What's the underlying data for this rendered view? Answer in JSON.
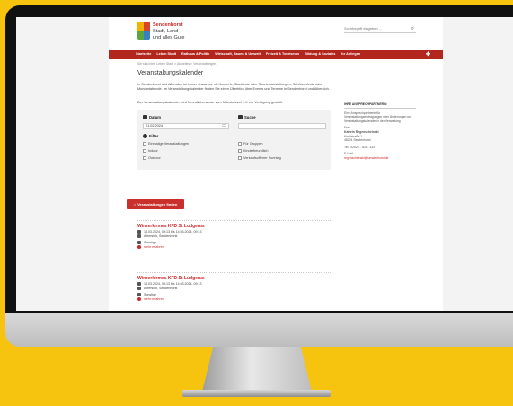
{
  "site": {
    "logo_line1": "Sendenhorst",
    "logo_line2": "Stadt, Land",
    "logo_line3": "und alles Gute",
    "search_placeholder": "Suchbegriff eingeben ...",
    "nav": [
      "Startseite",
      "Leben Stadt",
      "Rathaus & Politik",
      "Wirtschaft, Bauen & Umwelt",
      "Freizeit & Tourismus",
      "Bildung & Soziales",
      "Ihr Anliegen"
    ]
  },
  "breadcrumb": "Sie sind hier: Leben Stadt > Aktuelles > Veranstaltungen",
  "page_title": "Veranstaltungskalender",
  "intro": "In Sendenhorst und Albersloh ist immer etwas los: ob Konzerte, Stadtfeste oder Sportveranstaltungen, Schützenfeste oder Mundartabende. Im Veranstaltungskalender finden Sie einen Überblick über Events und Termine in Sendenhorst und Albersloh.",
  "intro2": "Der Veranstaltungskalender wird freundlicherweise vom Münsterland e.V. zur Verfügung gestellt.",
  "form": {
    "date_label": "Datum",
    "date_value": "01.02.2024",
    "search_label": "Suche",
    "filter_label": "Filter",
    "checkboxes": [
      "Einmalige Veranstaltungen",
      "Indoor",
      "Outdoor",
      "Für Gruppen",
      "Kinderfreundlich",
      "Verkaufsoffener Sonntag"
    ],
    "button": "Veranstaltungen finden"
  },
  "sidebar": {
    "heading": "IHRE ANSPRECHPARTNERIN",
    "text": "Eine Ansprechpartnerin für Veranstaltungseintragungen oder Änderungen im Veranstaltungskalender in der Verwaltung",
    "name_label": "Frau",
    "name": "Kathrin Regenscheinski",
    "street": "Kirchstraße 1",
    "city": "48324 Sendenhorst",
    "phone": "Tel.: 02526 - 303 - 133",
    "email_label": "E-Mail:",
    "email": "regenscheinski@sendenhorst.de"
  },
  "events": [
    {
      "title": "Winzerkirmes KFD St Ludgerus",
      "date": "14.03.2024, 09:13 bis 14.03.2024, 09:13",
      "place": "Albersloh, Sendenhorst",
      "category": "Sonstige",
      "more": "mehr erfahren"
    },
    {
      "title": "Winzerkirmes KFD St Ludgerus",
      "date": "14.03.2024, 09:13 bis 14.03.2024, 09:13",
      "place": "Albersloh, Sendenhorst",
      "category": "Sonstige",
      "more": "mehr erfahren"
    }
  ]
}
